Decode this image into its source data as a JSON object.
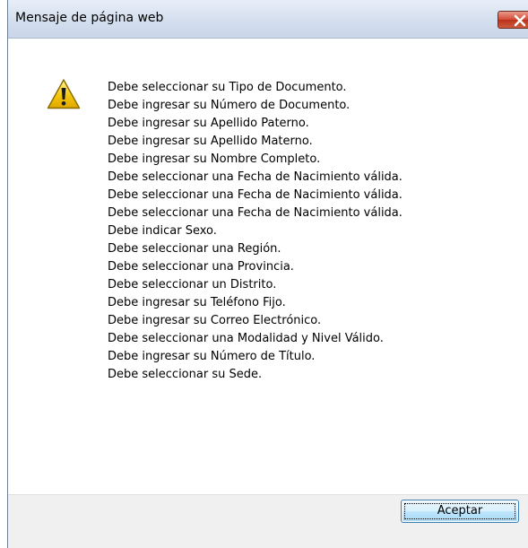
{
  "window": {
    "title": "Mensaje de página web"
  },
  "icons": {
    "message_icon": "warning-icon",
    "close_icon": "close-icon"
  },
  "colors": {
    "close_button": "#c9432c",
    "warning_yellow": "#f5c60a",
    "footer_background": "#f0f0f0"
  },
  "messages": [
    "Debe seleccionar su Tipo de Documento.",
    "Debe ingresar su Número de Documento.",
    "Debe ingresar su Apellido Paterno.",
    "Debe ingresar su Apellido Materno.",
    "Debe ingresar su Nombre Completo.",
    "Debe seleccionar una Fecha de Nacimiento válida.",
    "Debe seleccionar una Fecha de Nacimiento válida.",
    "Debe seleccionar una Fecha de Nacimiento válida.",
    "Debe indicar Sexo.",
    "Debe seleccionar una Región.",
    "Debe seleccionar una Provincia.",
    "Debe seleccionar un Distrito.",
    "Debe ingresar su Teléfono Fijo.",
    "Debe ingresar su Correo Electrónico.",
    "Debe seleccionar una Modalidad y Nivel Válido.",
    "Debe ingresar su Número de Título.",
    "Debe seleccionar su Sede."
  ],
  "buttons": {
    "ok_label": "Aceptar"
  }
}
